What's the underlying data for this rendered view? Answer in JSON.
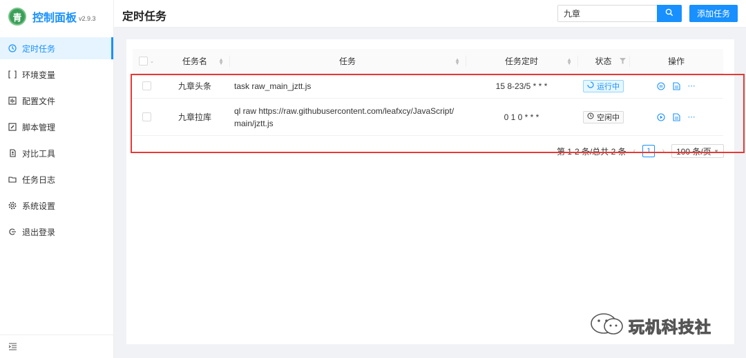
{
  "brand": {
    "logo_text": "青",
    "title": "控制面板",
    "version": "v2.9.3"
  },
  "sidebar": {
    "items": [
      {
        "label": "定时任务",
        "icon": "clock-icon",
        "active": true
      },
      {
        "label": "环境变量",
        "icon": "variable-icon",
        "active": false
      },
      {
        "label": "配置文件",
        "icon": "config-file-icon",
        "active": false
      },
      {
        "label": "脚本管理",
        "icon": "edit-icon",
        "active": false
      },
      {
        "label": "对比工具",
        "icon": "diff-icon",
        "active": false
      },
      {
        "label": "任务日志",
        "icon": "folder-icon",
        "active": false
      },
      {
        "label": "系统设置",
        "icon": "gear-icon",
        "active": false
      },
      {
        "label": "退出登录",
        "icon": "logout-icon",
        "active": false
      }
    ],
    "collapse_icon": "menu-fold-icon"
  },
  "header": {
    "title": "定时任务",
    "search_value": "九章",
    "add_label": "添加任务"
  },
  "table": {
    "columns": [
      "任务名",
      "任务",
      "任务定时",
      "状态",
      "操作"
    ],
    "rows": [
      {
        "name": "九章头条",
        "command": "task raw_main_jztt.js",
        "cron": "15 8-23/5 * * *",
        "status": "运行中",
        "status_icon": "loading-icon"
      },
      {
        "name": "九章拉库",
        "command": "ql raw https://raw.githubusercontent.com/leafxcy/JavaScript/main/jztt.js",
        "cron": "0 1 0 * * *",
        "status": "空闲中",
        "status_icon": "clock-icon"
      }
    ]
  },
  "pagination": {
    "summary": "第 1-2 条/总共 2 条",
    "page": "1",
    "page_size": "100 条/页"
  },
  "watermark": {
    "text": "玩机科技社"
  },
  "colors": {
    "primary": "#1890ff",
    "highlight": "#e53935"
  }
}
